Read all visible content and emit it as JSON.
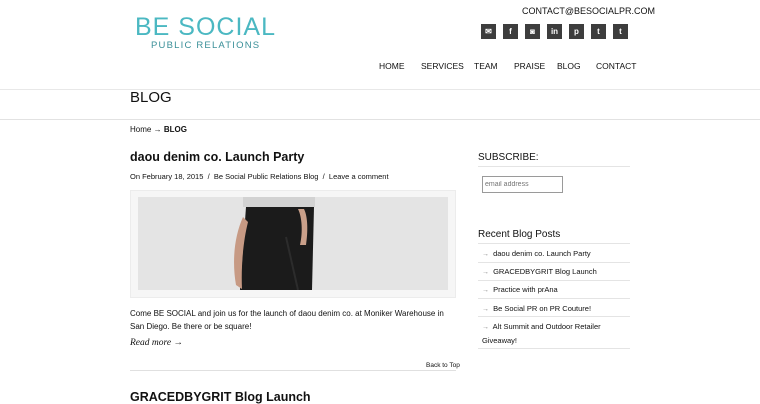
{
  "header": {
    "logo_main": "BE SOCIAL",
    "logo_sub": "PUBLIC RELATIONS",
    "contact_email": "CONTACT@BESOCIALPR.COM",
    "social_icons": [
      "email-icon",
      "facebook-icon",
      "instagram-icon",
      "linkedin-icon",
      "pinterest-icon",
      "tumblr-icon",
      "twitter-icon"
    ],
    "social_glyphs": [
      "✉",
      "f",
      "◙",
      "in",
      "p",
      "t",
      "t"
    ]
  },
  "nav": [
    "HOME",
    "SERVICES",
    "TEAM",
    "PRAISE",
    "BLOG",
    "CONTACT"
  ],
  "page": {
    "title": "BLOG",
    "breadcrumb_home": "Home",
    "breadcrumb_sep": "→",
    "breadcrumb_current": "BLOG"
  },
  "post": {
    "title": "daou denim co. Launch Party",
    "date": "On February 18, 2015",
    "sep": "/",
    "category": "Be Social Public Relations Blog",
    "comment": "Leave a comment",
    "excerpt": "Come BE SOCIAL and join us for the launch of daou denim co. at Moniker Warehouse in San Diego. Be there or be square!",
    "read_more": "Read more →",
    "back_to_top": "Back to Top"
  },
  "next_post_title": "GRACEDBYGRIT Blog Launch",
  "sidebar": {
    "subscribe_heading": "SUBSCRIBE:",
    "email_placeholder": "email address",
    "recent_heading": "Recent Blog Posts",
    "recent_arrow": "→",
    "recent": [
      "daou denim co. Launch Party",
      "GRACEDBYGRIT Blog Launch",
      "Practice with prAna",
      "Be Social PR on PR Couture!",
      "Alt Summit and Outdoor Retailer Giveaway!"
    ]
  },
  "colors": {
    "brand": "#4bb8c2",
    "brand_dark": "#3a8f98",
    "icon_bg": "#3d3d3d"
  }
}
